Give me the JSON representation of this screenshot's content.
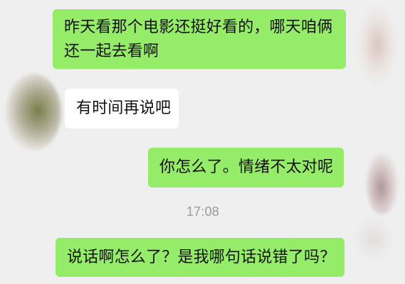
{
  "conversation": {
    "messages": [
      {
        "text": "昨天看那个电影还挺好看的，哪天咱俩还一起去看啊",
        "sender": "self",
        "bubble_color": "#95ec69"
      },
      {
        "text": "有时间再说吧",
        "sender": "other",
        "bubble_color": "#ffffff"
      },
      {
        "text": "你怎么了。情绪不太对呢",
        "sender": "self",
        "bubble_color": "#95ec69"
      },
      {
        "text": "说话啊怎么了？是我哪句话说错了吗？",
        "sender": "self",
        "bubble_color": "#95ec69"
      }
    ],
    "timestamp": "17:08"
  }
}
